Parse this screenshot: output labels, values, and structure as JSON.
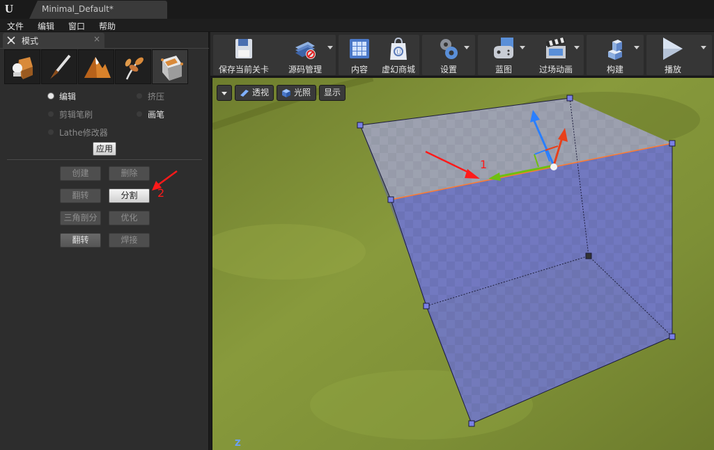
{
  "window": {
    "doc_tab_title": "Minimal_Default*"
  },
  "menu": [
    "文件",
    "编辑",
    "窗口",
    "帮助"
  ],
  "panel": {
    "tab_label": "模式",
    "tab_close": "×",
    "mode_icons": [
      "place-mode-icon",
      "paint-mode-icon",
      "landscape-mode-icon",
      "foliage-mode-icon",
      "geometry-edit-mode-icon"
    ],
    "radio_options": [
      {
        "label": "编辑",
        "selected": true
      },
      {
        "label": "挤压",
        "selected": false
      },
      {
        "label": "剪辑笔刷",
        "selected": false
      },
      {
        "label": "画笔",
        "selected": false
      },
      {
        "label": "Lathe修改器",
        "selected": false
      }
    ],
    "apply_label": "应用",
    "tools": [
      {
        "label": "创建",
        "state": "dim"
      },
      {
        "label": "删除",
        "state": "dim"
      },
      {
        "label": "翻转",
        "state": "dim"
      },
      {
        "label": "分割",
        "state": "lit"
      },
      {
        "label": "三角剖分",
        "state": "dim"
      },
      {
        "label": "优化",
        "state": "dim"
      },
      {
        "label": "翻转",
        "state": "semi"
      },
      {
        "label": "焊接",
        "state": "dim"
      }
    ]
  },
  "toolbar": [
    {
      "label": "保存当前关卡",
      "icon": "save-icon",
      "dropdown": false
    },
    {
      "label": "源码管理",
      "icon": "source-control-icon",
      "dropdown": true
    },
    {
      "label": "内容",
      "icon": "content-icon",
      "dropdown": false
    },
    {
      "label": "虚幻商城",
      "icon": "marketplace-icon",
      "dropdown": false
    },
    {
      "label": "设置",
      "icon": "settings-icon",
      "dropdown": true
    },
    {
      "label": "蓝图",
      "icon": "blueprint-icon",
      "dropdown": true
    },
    {
      "label": "过场动画",
      "icon": "cinematics-icon",
      "dropdown": true
    },
    {
      "label": "构建",
      "icon": "build-icon",
      "dropdown": true
    },
    {
      "label": "播放",
      "icon": "play-icon",
      "dropdown": true
    }
  ],
  "viewport": {
    "perspective_label": "透视",
    "lighting_label": "光照",
    "show_label": "显示",
    "axis_label": "Z"
  },
  "annotations": {
    "arrow1_label": "1",
    "arrow2_label": "2"
  },
  "colors": {
    "selection_edge": "#ff7a30",
    "brush_fill": "#6f74cf",
    "gizmo_z": "#2a7fff",
    "gizmo_x": "#e8401a",
    "gizmo_y": "#6fbf10",
    "annotation": "#ff1a1a"
  }
}
